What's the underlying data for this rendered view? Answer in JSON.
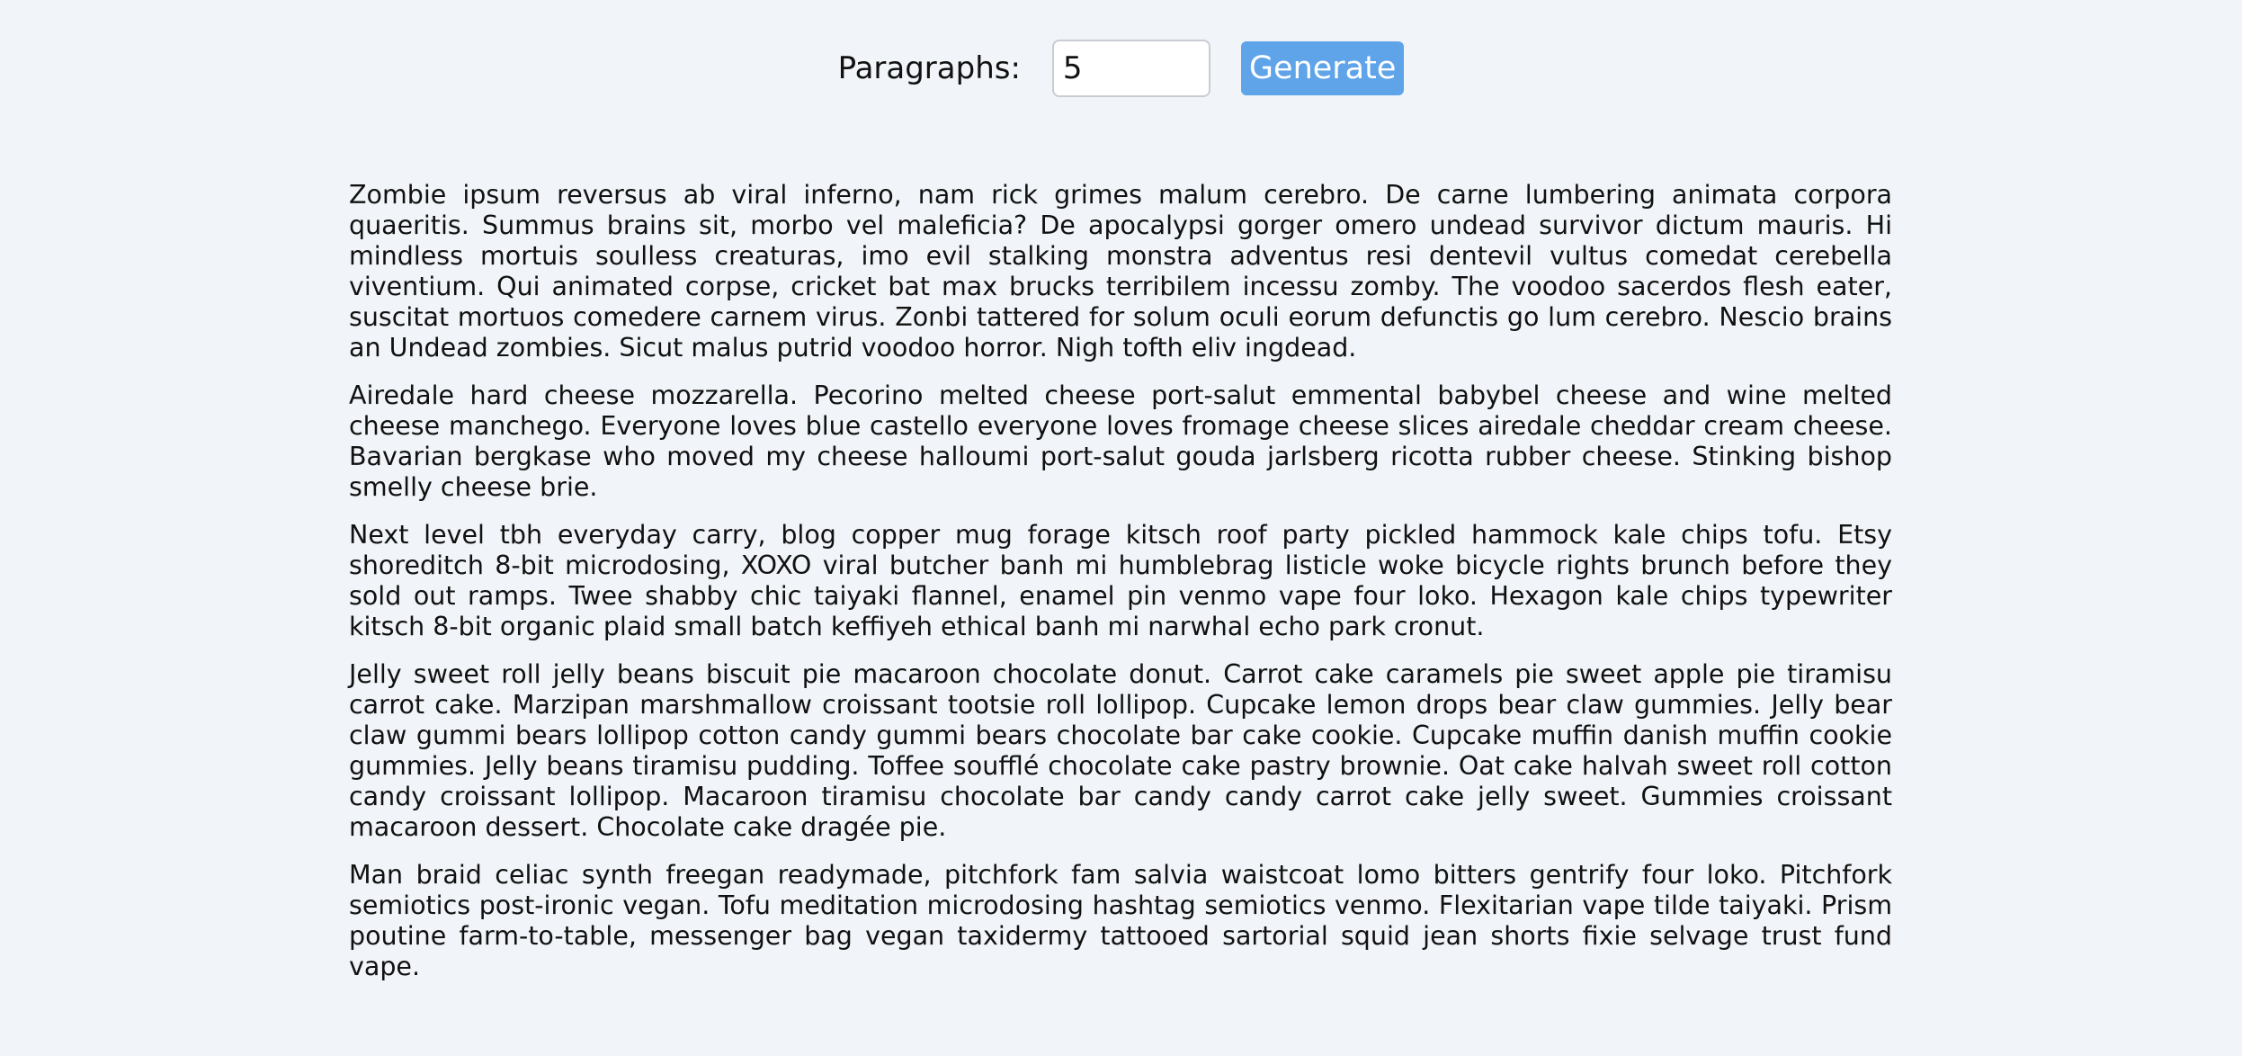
{
  "controls": {
    "label": "Paragraphs:",
    "input_value": "5",
    "button_label": "Generate"
  },
  "paragraphs": [
    "Zombie ipsum reversus ab viral inferno, nam rick grimes malum cerebro. De carne lumbering animata corpora quaeritis. Summus brains sit, morbo vel maleficia? De apocalypsi gorger omero undead survivor dictum mauris. Hi mindless mortuis soulless creaturas, imo evil stalking monstra adventus resi dentevil vultus comedat cerebella viventium. Qui animated corpse, cricket bat max brucks terribilem incessu zomby. The voodoo sacerdos flesh eater, suscitat mortuos comedere carnem virus. Zonbi tattered for solum oculi eorum defunctis go lum cerebro. Nescio brains an Undead zombies. Sicut malus putrid voodoo horror. Nigh tofth eliv ingdead.",
    "Airedale hard cheese mozzarella. Pecorino melted cheese port-salut emmental babybel cheese and wine melted cheese manchego. Everyone loves blue castello everyone loves fromage cheese slices airedale cheddar cream cheese. Bavarian bergkase who moved my cheese halloumi port-salut gouda jarlsberg ricotta rubber cheese. Stinking bishop smelly cheese brie.",
    "Next level tbh everyday carry, blog copper mug forage kitsch roof party pickled hammock kale chips tofu. Etsy shoreditch 8-bit microdosing, XOXO viral butcher banh mi humblebrag listicle woke bicycle rights brunch before they sold out ramps. Twee shabby chic taiyaki flannel, enamel pin venmo vape four loko. Hexagon kale chips typewriter kitsch 8-bit organic plaid small batch keffiyeh ethical banh mi narwhal echo park cronut.",
    "Jelly sweet roll jelly beans biscuit pie macaroon chocolate donut. Carrot cake caramels pie sweet apple pie tiramisu carrot cake. Marzipan marshmallow croissant tootsie roll lollipop. Cupcake lemon drops bear claw gummies. Jelly bear claw gummi bears lollipop cotton candy gummi bears chocolate bar cake cookie. Cupcake muffin danish muffin cookie gummies. Jelly beans tiramisu pudding. Toffee soufflé chocolate cake pastry brownie. Oat cake halvah sweet roll cotton candy croissant lollipop. Macaroon tiramisu chocolate bar candy candy carrot cake jelly sweet. Gummies croissant macaroon dessert. Chocolate cake dragée pie.",
    "Man braid celiac synth freegan readymade, pitchfork fam salvia waistcoat lomo bitters gentrify four loko. Pitchfork semiotics post-ironic vegan. Tofu meditation microdosing hashtag semiotics venmo. Flexitarian vape tilde taiyaki. Prism poutine farm-to-table, messenger bag vegan taxidermy tattooed sartorial squid jean shorts fixie selvage trust fund vape."
  ]
}
